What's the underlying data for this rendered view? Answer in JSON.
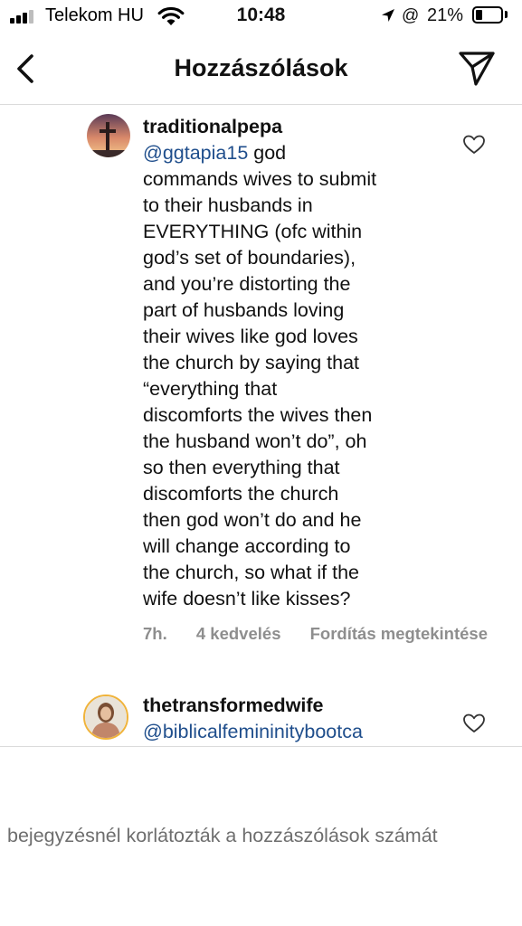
{
  "status_bar": {
    "carrier": "Telekom HU",
    "time": "10:48",
    "battery_percent": "21%"
  },
  "header": {
    "title": "Hozzászólások"
  },
  "comments": [
    {
      "username": "traditionalpepa",
      "mention": "@ggtapia15",
      "text_lines": [
        " god",
        "commands wives to submit",
        "to their husbands in",
        "EVERYTHING (ofc within",
        "god’s set of boundaries),",
        "and you’re distorting the",
        "part of husbands loving",
        "their wives like god loves",
        "the church by saying that",
        "“everything that",
        "discomforts the wives then",
        "the husband won’t do”, oh",
        "so then everything that",
        "discomforts the church",
        "then god won’t do and he",
        "will change according to",
        "the church, so what if the",
        "wife doesn’t like kisses?"
      ],
      "time_ago": "7h.",
      "likes": "4 kedvelés",
      "translation": "Fordítás megtekintése"
    },
    {
      "username": "thetransformedwife",
      "mention": "@biblicalfemininitybootca"
    }
  ],
  "footer": {
    "restricted_notice": "bejegyzésnél korlátozták a hozzászólások számát"
  }
}
